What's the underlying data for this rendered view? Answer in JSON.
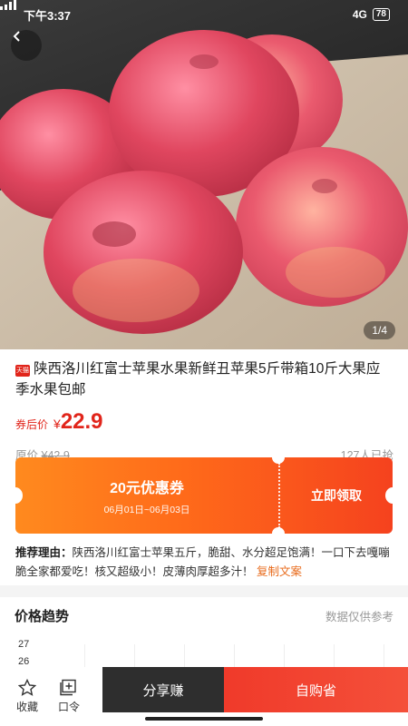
{
  "status_bar": {
    "time": "下午3:37",
    "network": "4G",
    "battery": "78"
  },
  "hero": {
    "counter": "1/4"
  },
  "product": {
    "title": "陕西洛川红富士苹果水果新鲜丑苹果5斤带箱10斤大果应季水果包邮",
    "badge": "天猫",
    "price_label": "券后价",
    "price_symbol": "¥",
    "price": "22.9",
    "original_label": "原价",
    "original_symbol": "¥",
    "original_price": "42.9",
    "sold": "127人已抢"
  },
  "coupon": {
    "amount": "20元优惠券",
    "date": "06月01日~06月03日",
    "action": "立即领取"
  },
  "reason": {
    "label": "推荐理由：",
    "text": "陕西洛川红富士苹果五斤，脆甜、水分超足饱满！一口下去嘎嘣脆全家都爱吃！核又超级小！皮薄肉厚超多汁！",
    "copy": "复制文案"
  },
  "trend": {
    "title": "价格趋势",
    "note": "数据仅供参考",
    "ticks": [
      "27",
      "26"
    ]
  },
  "bottom_bar": {
    "favorite": "收藏",
    "password": "口令",
    "share": "分享赚",
    "buy": "自购省"
  },
  "colors": {
    "accent": "#e1251b",
    "coupon_start": "#ff8a1e",
    "coupon_end": "#f5421e",
    "share_bg": "#2e2e2e"
  }
}
